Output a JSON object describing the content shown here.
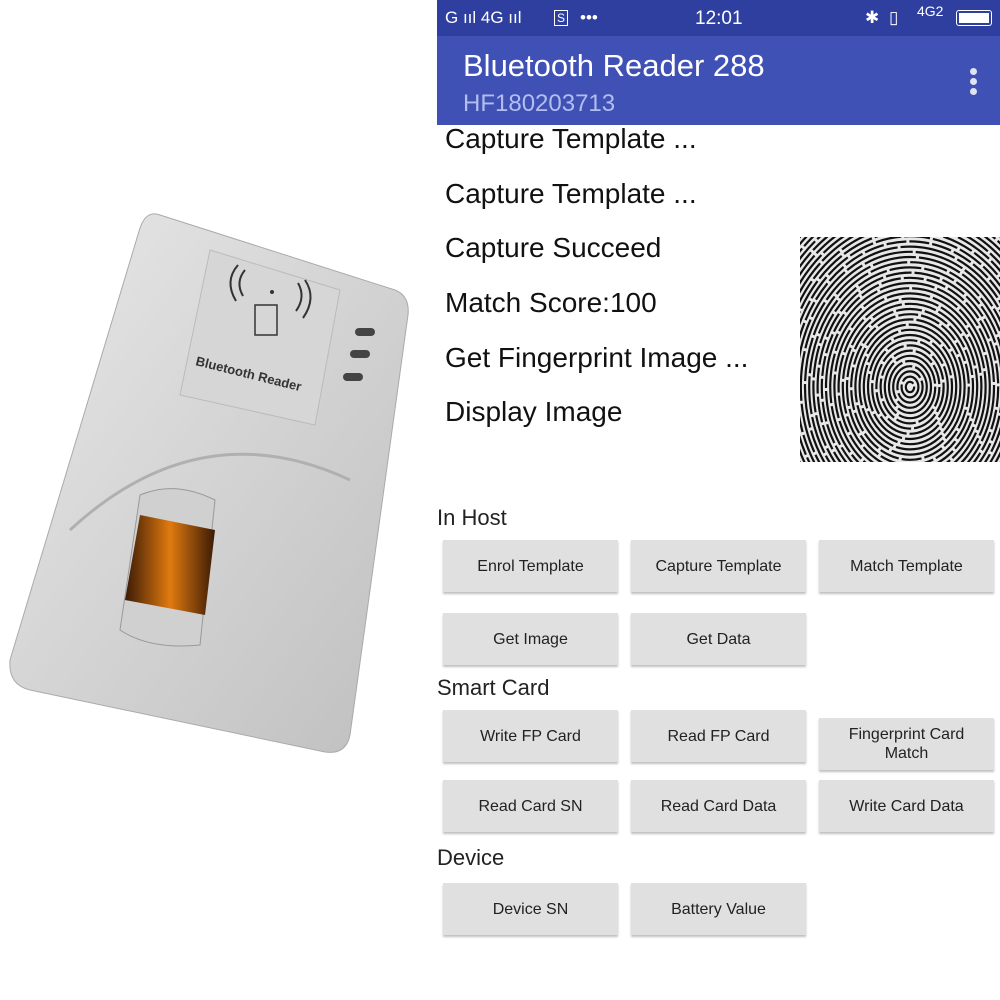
{
  "status_bar": {
    "signal": "G ııl 4G ııl",
    "sim_icon": "S",
    "more": "•••",
    "time": "12:01",
    "network": "4G2",
    "icons": [
      "bluetooth-icon",
      "vibrate-icon",
      "battery-icon"
    ]
  },
  "app_bar": {
    "title": "Bluetooth Reader 288",
    "subtitle": "HF180203713",
    "menu_icon": "more-vert-icon"
  },
  "log": [
    "Capture Template ...",
    "Capture Template ...",
    "Capture Succeed",
    "Match Score:100",
    "Get Fingerprint Image ...",
    "Display Image"
  ],
  "device_photo": {
    "label": "Bluetooth Reader"
  },
  "sections": {
    "in_host": {
      "label": "In Host",
      "buttons": [
        "Enrol Template",
        "Capture Template",
        "Match Template",
        "Get Image",
        "Get Data"
      ]
    },
    "smart_card": {
      "label": "Smart Card",
      "buttons": [
        "Write FP Card",
        "Read FP Card",
        "Fingerprint Card Match",
        "Read Card SN",
        "Read Card Data",
        "Write Card Data"
      ]
    },
    "device": {
      "label": "Device",
      "buttons": [
        "Device SN",
        "Battery Value"
      ]
    }
  },
  "colors": {
    "status_bar": "#2f3f9f",
    "app_bar": "#3f51b5",
    "button": "#e0e0e0"
  }
}
